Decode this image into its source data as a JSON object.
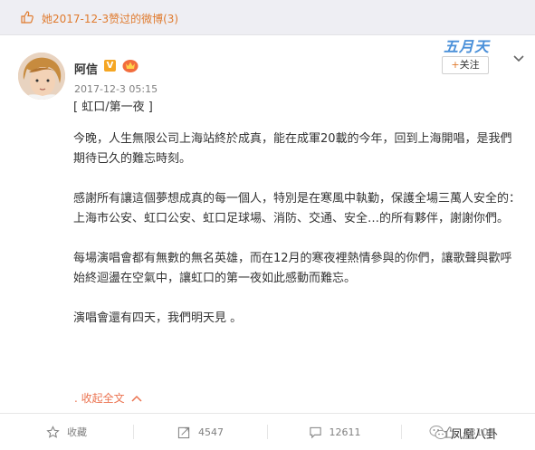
{
  "header": {
    "title": "她2017-12-3赞过的微博(3)",
    "like_icon": "thumbs-up-icon"
  },
  "post": {
    "author": "阿信",
    "verified_badge": "V",
    "timestamp": "2017-12-3 05:15",
    "title": "[ 虹口/第一夜 ]",
    "paragraphs": [
      "今晚，人生無限公司上海站終於成真，能在成軍20載的今年，回到上海開唱，是我們期待已久的難忘時刻。",
      "感謝所有讓這個夢想成真的每一個人，特別是在寒風中執勤，保護全場三萬人安全的：上海市公安、虹口公安、虹口足球場、消防、交通、安全…的所有夥伴，謝謝你們。",
      "每場演唱會都有無數的無名英雄，而在12月的寒夜裡熱情參與的你們，讓歌聲與歡呼始終迴盪在空氣中，讓虹口的第一夜如此感動而難忘。",
      "演唱會還有四天，我們明天見 。"
    ],
    "collapse_label": ". 收起全文",
    "follow_label": "关注",
    "follow_plus": "+"
  },
  "actions": {
    "favorite_label": "收藏",
    "repost_count": "4547",
    "comment_count": "12611",
    "like_count": "43108"
  },
  "watermarks": {
    "top": "五月天",
    "bottom": "凤凰八卦"
  },
  "colors": {
    "accent": "#eb7350",
    "header_text": "#e07b2e",
    "muted": "#808080"
  }
}
